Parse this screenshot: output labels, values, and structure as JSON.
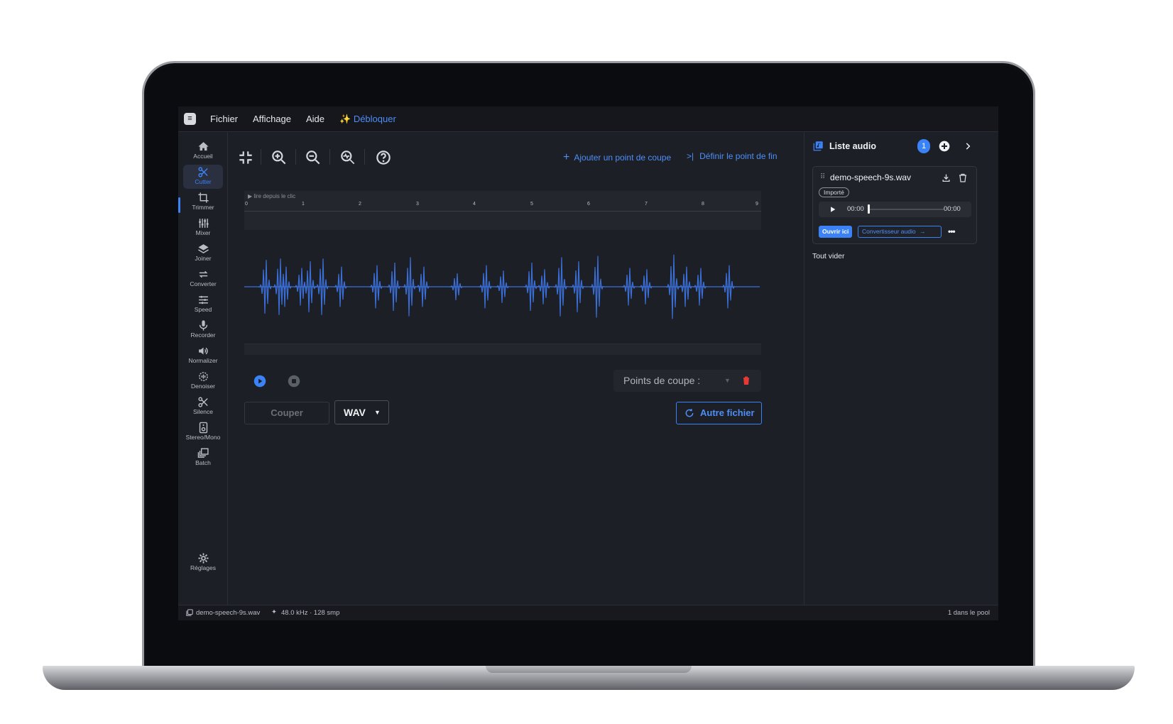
{
  "menu": {
    "logo_glyph": "≡",
    "file": "Fichier",
    "view": "Affichage",
    "help": "Aide",
    "unlock": "✨ Débloquer"
  },
  "sidebar": {
    "items": [
      {
        "label": "Accueil",
        "icon": "home-icon"
      },
      {
        "label": "Cutter",
        "icon": "scissors-icon",
        "active": true
      },
      {
        "label": "Trimmer",
        "icon": "crop-icon"
      },
      {
        "label": "Mixer",
        "icon": "sliders-icon"
      },
      {
        "label": "Joiner",
        "icon": "layers-icon"
      },
      {
        "label": "Converter",
        "icon": "swap-icon"
      },
      {
        "label": "Speed",
        "icon": "tune-icon"
      },
      {
        "label": "Recorder",
        "icon": "mic-icon"
      },
      {
        "label": "Normalizer",
        "icon": "volume-icon"
      },
      {
        "label": "Denoiser",
        "icon": "denoise-icon"
      },
      {
        "label": "Silence",
        "icon": "scissors-icon"
      },
      {
        "label": "Stereo/Mono",
        "icon": "speaker-icon"
      },
      {
        "label": "Batch",
        "icon": "batch-icon"
      }
    ],
    "settings": "Réglages"
  },
  "toolbar": {
    "add_cut": "Ajouter un point de coupe",
    "set_end": "Définir le point de fin"
  },
  "timeline": {
    "hint": "▶ lire depuis le clic",
    "ticks": [
      "0",
      "1",
      "2",
      "3",
      "4",
      "5",
      "6",
      "7",
      "8",
      "9"
    ]
  },
  "waveform": {
    "color": "#3b6fd8"
  },
  "cutpoints": {
    "label": "Points de coupe :"
  },
  "actions": {
    "cut": "Couper",
    "format": "WAV",
    "other_file": "Autre fichier"
  },
  "audio_list": {
    "title": "Liste audio",
    "count": "1",
    "clear_all": "Tout vider",
    "item": {
      "name": "demo-speech-9s.wav",
      "badge": "Importé",
      "time_current": "00:00",
      "time_total": "00:00",
      "progress": 0,
      "open_here": "Ouvrir ici",
      "converter": "Convertisseur audio"
    }
  },
  "status": {
    "file": "demo-speech-9s.wav",
    "info": "48.0 kHz · 128 smp",
    "pool": "1 dans le pool"
  },
  "colors": {
    "accent": "#3b82f6",
    "danger": "#e53935",
    "background": "#1c1f26"
  }
}
